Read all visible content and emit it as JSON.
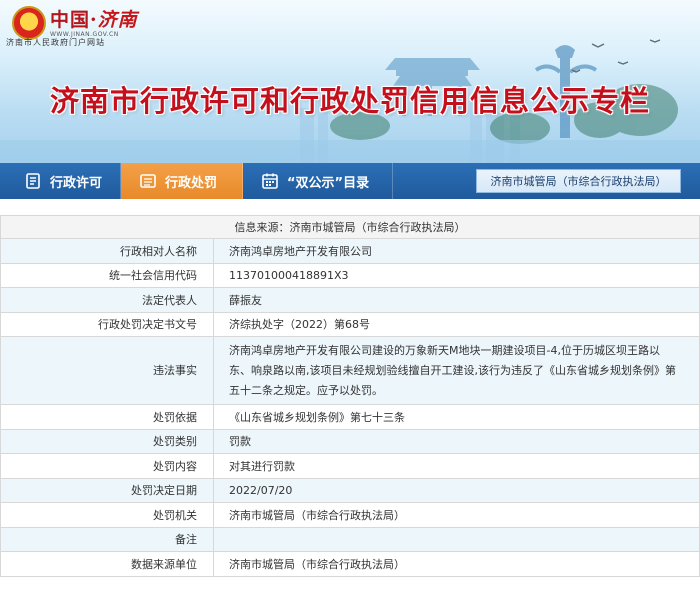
{
  "header": {
    "logo_title_main": "中国·",
    "logo_title_city": "济南",
    "logo_url": "WWW.JINAN.GOV.CN",
    "logo_subtitle": "济南市人民政府门户网站",
    "banner_title": "济南市行政许可和行政处罚信用信息公示专栏"
  },
  "nav": {
    "items": [
      {
        "label": "行政许可",
        "icon": "document-icon"
      },
      {
        "label": "行政处罚",
        "icon": "list-icon"
      },
      {
        "label": "“双公示”目录",
        "icon": "calendar-icon"
      }
    ],
    "org_box": "济南市城管局（市综合行政执法局）"
  },
  "record": {
    "source": "信息来源：济南市城管局（市综合行政执法局）",
    "rows": [
      {
        "label": "行政相对人名称",
        "value": "济南鸿卓房地产开发有限公司"
      },
      {
        "label": "统一社会信用代码",
        "value": "113701000418891X3"
      },
      {
        "label": "法定代表人",
        "value": "薛振友"
      },
      {
        "label": "行政处罚决定书文号",
        "value": "济综执处字（2022）第68号"
      },
      {
        "label": "违法事实",
        "value": "济南鸿卓房地产开发有限公司建设的万象新天M地块一期建设项目-4,位于历城区坝王路以东、响泉路以南,该项目未经规划验线擅自开工建设,该行为违反了《山东省城乡规划条例》第五十二条之规定。应予以处罚。"
      },
      {
        "label": "处罚依据",
        "value": "《山东省城乡规划条例》第七十三条"
      },
      {
        "label": "处罚类别",
        "value": "罚款"
      },
      {
        "label": "处罚内容",
        "value": "对其进行罚款"
      },
      {
        "label": "处罚决定日期",
        "value": "2022/07/20"
      },
      {
        "label": "处罚机关",
        "value": "济南市城管局（市综合行政执法局）"
      },
      {
        "label": "备注",
        "value": ""
      },
      {
        "label": "数据来源单位",
        "value": "济南市城管局（市综合行政执法局）"
      }
    ]
  },
  "colors": {
    "title_red": "#c4101c",
    "nav_blue": "#1f5a9c",
    "nav_active_orange": "#e88a2a",
    "row_tint": "#ecf6fb"
  }
}
